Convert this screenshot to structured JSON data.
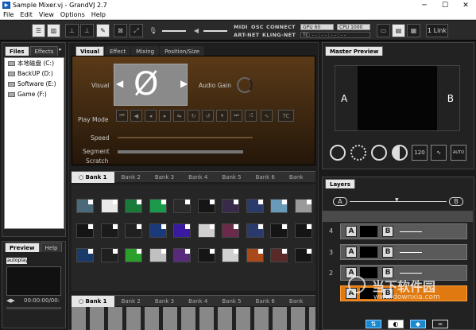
{
  "window": {
    "title": "Sample Mixer.vj - GrandVJ 2.7",
    "app_icon": "grandvj-logo-icon",
    "min": "─",
    "max": "☐",
    "close": "✕"
  },
  "menu": [
    "File",
    "Edit",
    "View",
    "Options",
    "Help"
  ],
  "toolbar": {
    "labels": {
      "midi": "MIDI",
      "osc": "OSC",
      "connect": "CONNECT",
      "artnet": "ART-NET",
      "klingnet": "KLING-NET"
    },
    "gpu": "GPU 60",
    "cpu": "CPU 1000",
    "tc": "TC: - - : - - : - - : - -",
    "link": "1 Link"
  },
  "browser": {
    "tabs": [
      "Files",
      "Effects"
    ],
    "drives": [
      "本地磁盘 (C:)",
      "BackUP (D:)",
      "Software (E:)",
      "Game (F:)"
    ],
    "preview_tabs": [
      "Preview",
      "Help"
    ],
    "autoplay": "autoplay",
    "timecode": "00:00:00/00:"
  },
  "visual_panel": {
    "tabs": [
      "Visual",
      "Effect",
      "Mixing",
      "Position/Size"
    ],
    "visual_label": "Visual",
    "audio_gain": "Audio Gain",
    "play_mode": "Play Mode",
    "speed": "Speed",
    "segment": "Segment",
    "scratch": "Scratch",
    "empty_symbol": "Ø",
    "tc_btn": "TC"
  },
  "banks": [
    "Bank 1",
    "Bank 2",
    "Bank 3",
    "Bank 4",
    "Bank 5",
    "Bank 6",
    "Bank"
  ],
  "clip_colors": [
    "#4a6a7a",
    "#e8e8e8",
    "#1a7a3a",
    "#1a9a4a",
    "#2a2a2a",
    "#151515",
    "#3a2a4a",
    "#2a3a6a",
    "#6a9aba",
    "#9a9a9a",
    "#151515",
    "#1a1a1a",
    "#202020",
    "#1a3a7a",
    "#3a1aa0",
    "#d0d0d0",
    "#6a2a4a",
    "#2a3a6a",
    "#151515",
    "#151515",
    "#1a3a6a",
    "#202020",
    "#2aa02a",
    "#c0c0c0",
    "#5a2a7a",
    "#151515",
    "#d0d0d0",
    "#aa4a1a",
    "#5a2a2a",
    "#151515"
  ],
  "master": {
    "title": "Master Preview",
    "a": "A",
    "b": "B",
    "bpm": "120",
    "auto": "AUTO"
  },
  "layers": {
    "title": "Layers",
    "a": "A",
    "b": "B",
    "rows": [
      "4",
      "3",
      "2"
    ]
  },
  "watermark": {
    "brand": "当下软件园",
    "url": "www.downxia.com"
  }
}
